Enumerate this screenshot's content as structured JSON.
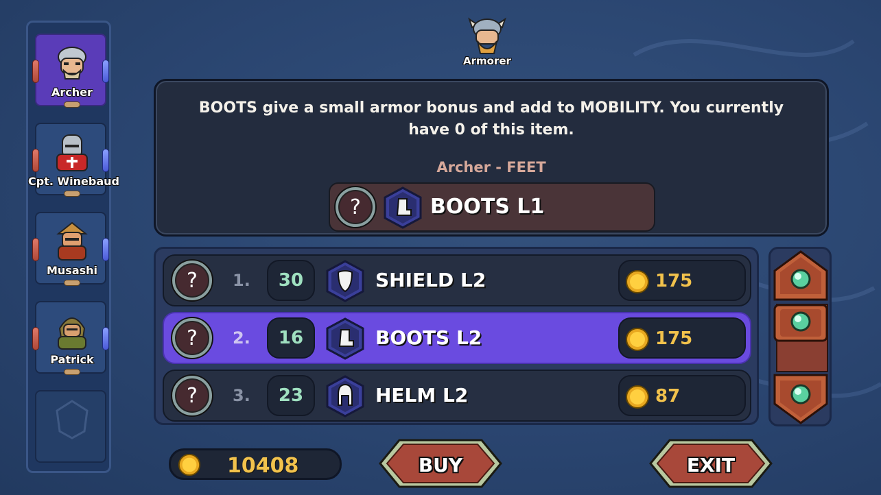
{
  "party": {
    "heroes": [
      {
        "name": "Archer",
        "active": true
      },
      {
        "name": "Cpt. Winebaud",
        "active": false
      },
      {
        "name": "Musashi",
        "active": false
      },
      {
        "name": "Patrick",
        "active": false
      }
    ]
  },
  "vendor": {
    "name": "Armorer"
  },
  "info": {
    "description": "BOOTS give a small armor bonus and add to MOBILITY. You currently have 0 of this item.",
    "slot_label": "Archer - FEET",
    "equipped_item": "BOOTS L1",
    "equipped_help": "?"
  },
  "shop": {
    "rows": [
      {
        "help": "?",
        "index": "1.",
        "qty": "30",
        "name": "SHIELD L2",
        "price": "175",
        "icon": "shield-icon",
        "selected": false
      },
      {
        "help": "?",
        "index": "2.",
        "qty": "16",
        "name": "BOOTS L2",
        "price": "175",
        "icon": "boots-icon",
        "selected": true
      },
      {
        "help": "?",
        "index": "3.",
        "qty": "23",
        "name": "HELM L2",
        "price": "87",
        "icon": "helm-icon",
        "selected": false
      }
    ]
  },
  "gold": {
    "amount": "10408"
  },
  "buttons": {
    "buy": "BUY",
    "exit": "EXIT"
  },
  "colors": {
    "selected_row": "#6a4be0",
    "active_hero": "#5a3cb8",
    "gold": "#f2c24c",
    "button_red": "#a8483a"
  }
}
